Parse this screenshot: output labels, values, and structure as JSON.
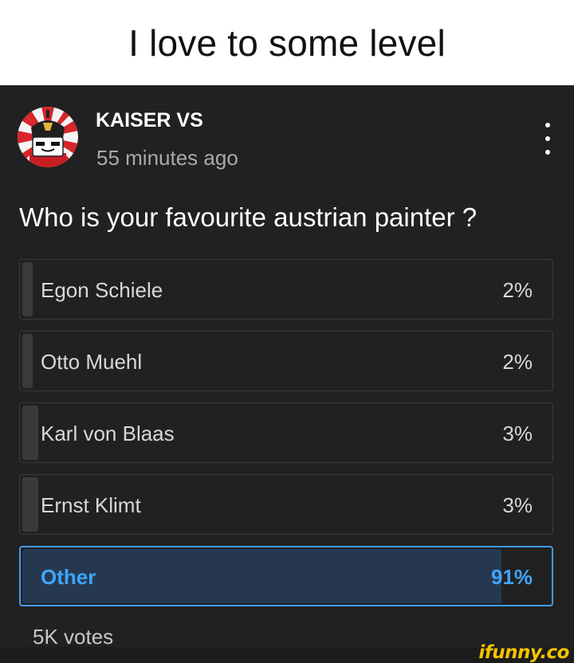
{
  "caption": {
    "text": "I love to some level"
  },
  "post": {
    "author": "KAISER VS",
    "timestamp": "55 minutes ago",
    "avatar_icon": "kaiser-avatar-icon",
    "menu_icon": "more-vertical-icon"
  },
  "poll": {
    "question": "Who is your favourite austrian painter ?",
    "options": [
      {
        "label": "Egon Schiele",
        "percent_text": "2%",
        "percent": 2,
        "selected": false
      },
      {
        "label": "Otto Muehl",
        "percent_text": "2%",
        "percent": 2,
        "selected": false
      },
      {
        "label": "Karl von Blaas",
        "percent_text": "3%",
        "percent": 3,
        "selected": false
      },
      {
        "label": "Ernst Klimt",
        "percent_text": "3%",
        "percent": 3,
        "selected": false
      },
      {
        "label": "Other",
        "percent_text": "91%",
        "percent": 91,
        "selected": true
      }
    ],
    "votes": "5K votes"
  },
  "watermark": {
    "text": "ifunny.co",
    "color": "#f5c400"
  },
  "colors": {
    "background": "#212121",
    "accent": "#3ea6ff",
    "selected_fill": "#263850",
    "option_fill": "#3a3a3a"
  }
}
